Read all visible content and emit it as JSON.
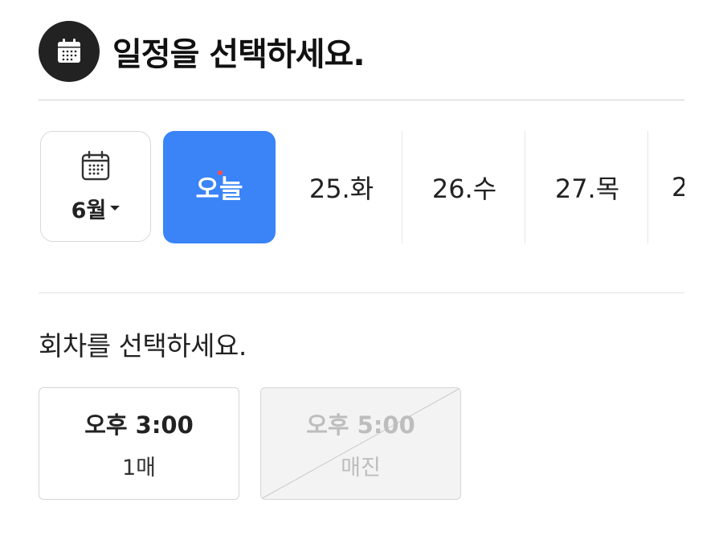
{
  "header": {
    "title": "일정을 선택하세요.",
    "icon": "calendar-icon"
  },
  "date_picker": {
    "month_label": "6월",
    "month_icon": "calendar-icon",
    "days": [
      {
        "label": "오늘",
        "selected": true,
        "has_dot": true
      },
      {
        "label": "25.화",
        "selected": false
      },
      {
        "label": "26.수",
        "selected": false
      },
      {
        "label": "27.목",
        "selected": false
      },
      {
        "label": "2",
        "selected": false
      }
    ]
  },
  "sessions": {
    "title": "회차를 선택하세요.",
    "slots": [
      {
        "time": "오후 3:00",
        "remaining": "1매",
        "sold_out": false
      },
      {
        "time": "오후 5:00",
        "remaining": "매진",
        "sold_out": true
      }
    ]
  },
  "colors": {
    "accent": "#3a84f7",
    "today_dot": "#ff4d4d",
    "header_icon_bg": "#222222",
    "disabled_text": "#bdbdbd"
  }
}
